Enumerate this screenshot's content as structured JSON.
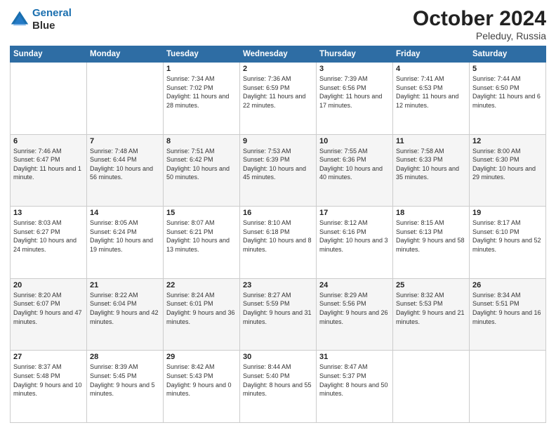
{
  "header": {
    "logo_line1": "General",
    "logo_line2": "Blue",
    "title": "October 2024",
    "subtitle": "Peleduy, Russia"
  },
  "days_of_week": [
    "Sunday",
    "Monday",
    "Tuesday",
    "Wednesday",
    "Thursday",
    "Friday",
    "Saturday"
  ],
  "weeks": [
    [
      {
        "day": "",
        "info": ""
      },
      {
        "day": "",
        "info": ""
      },
      {
        "day": "1",
        "info": "Sunrise: 7:34 AM\nSunset: 7:02 PM\nDaylight: 11 hours\nand 28 minutes."
      },
      {
        "day": "2",
        "info": "Sunrise: 7:36 AM\nSunset: 6:59 PM\nDaylight: 11 hours\nand 22 minutes."
      },
      {
        "day": "3",
        "info": "Sunrise: 7:39 AM\nSunset: 6:56 PM\nDaylight: 11 hours\nand 17 minutes."
      },
      {
        "day": "4",
        "info": "Sunrise: 7:41 AM\nSunset: 6:53 PM\nDaylight: 11 hours\nand 12 minutes."
      },
      {
        "day": "5",
        "info": "Sunrise: 7:44 AM\nSunset: 6:50 PM\nDaylight: 11 hours\nand 6 minutes."
      }
    ],
    [
      {
        "day": "6",
        "info": "Sunrise: 7:46 AM\nSunset: 6:47 PM\nDaylight: 11 hours\nand 1 minute."
      },
      {
        "day": "7",
        "info": "Sunrise: 7:48 AM\nSunset: 6:44 PM\nDaylight: 10 hours\nand 56 minutes."
      },
      {
        "day": "8",
        "info": "Sunrise: 7:51 AM\nSunset: 6:42 PM\nDaylight: 10 hours\nand 50 minutes."
      },
      {
        "day": "9",
        "info": "Sunrise: 7:53 AM\nSunset: 6:39 PM\nDaylight: 10 hours\nand 45 minutes."
      },
      {
        "day": "10",
        "info": "Sunrise: 7:55 AM\nSunset: 6:36 PM\nDaylight: 10 hours\nand 40 minutes."
      },
      {
        "day": "11",
        "info": "Sunrise: 7:58 AM\nSunset: 6:33 PM\nDaylight: 10 hours\nand 35 minutes."
      },
      {
        "day": "12",
        "info": "Sunrise: 8:00 AM\nSunset: 6:30 PM\nDaylight: 10 hours\nand 29 minutes."
      }
    ],
    [
      {
        "day": "13",
        "info": "Sunrise: 8:03 AM\nSunset: 6:27 PM\nDaylight: 10 hours\nand 24 minutes."
      },
      {
        "day": "14",
        "info": "Sunrise: 8:05 AM\nSunset: 6:24 PM\nDaylight: 10 hours\nand 19 minutes."
      },
      {
        "day": "15",
        "info": "Sunrise: 8:07 AM\nSunset: 6:21 PM\nDaylight: 10 hours\nand 13 minutes."
      },
      {
        "day": "16",
        "info": "Sunrise: 8:10 AM\nSunset: 6:18 PM\nDaylight: 10 hours\nand 8 minutes."
      },
      {
        "day": "17",
        "info": "Sunrise: 8:12 AM\nSunset: 6:16 PM\nDaylight: 10 hours\nand 3 minutes."
      },
      {
        "day": "18",
        "info": "Sunrise: 8:15 AM\nSunset: 6:13 PM\nDaylight: 9 hours\nand 58 minutes."
      },
      {
        "day": "19",
        "info": "Sunrise: 8:17 AM\nSunset: 6:10 PM\nDaylight: 9 hours\nand 52 minutes."
      }
    ],
    [
      {
        "day": "20",
        "info": "Sunrise: 8:20 AM\nSunset: 6:07 PM\nDaylight: 9 hours\nand 47 minutes."
      },
      {
        "day": "21",
        "info": "Sunrise: 8:22 AM\nSunset: 6:04 PM\nDaylight: 9 hours\nand 42 minutes."
      },
      {
        "day": "22",
        "info": "Sunrise: 8:24 AM\nSunset: 6:01 PM\nDaylight: 9 hours\nand 36 minutes."
      },
      {
        "day": "23",
        "info": "Sunrise: 8:27 AM\nSunset: 5:59 PM\nDaylight: 9 hours\nand 31 minutes."
      },
      {
        "day": "24",
        "info": "Sunrise: 8:29 AM\nSunset: 5:56 PM\nDaylight: 9 hours\nand 26 minutes."
      },
      {
        "day": "25",
        "info": "Sunrise: 8:32 AM\nSunset: 5:53 PM\nDaylight: 9 hours\nand 21 minutes."
      },
      {
        "day": "26",
        "info": "Sunrise: 8:34 AM\nSunset: 5:51 PM\nDaylight: 9 hours\nand 16 minutes."
      }
    ],
    [
      {
        "day": "27",
        "info": "Sunrise: 8:37 AM\nSunset: 5:48 PM\nDaylight: 9 hours\nand 10 minutes."
      },
      {
        "day": "28",
        "info": "Sunrise: 8:39 AM\nSunset: 5:45 PM\nDaylight: 9 hours\nand 5 minutes."
      },
      {
        "day": "29",
        "info": "Sunrise: 8:42 AM\nSunset: 5:43 PM\nDaylight: 9 hours\nand 0 minutes."
      },
      {
        "day": "30",
        "info": "Sunrise: 8:44 AM\nSunset: 5:40 PM\nDaylight: 8 hours\nand 55 minutes."
      },
      {
        "day": "31",
        "info": "Sunrise: 8:47 AM\nSunset: 5:37 PM\nDaylight: 8 hours\nand 50 minutes."
      },
      {
        "day": "",
        "info": ""
      },
      {
        "day": "",
        "info": ""
      }
    ]
  ]
}
